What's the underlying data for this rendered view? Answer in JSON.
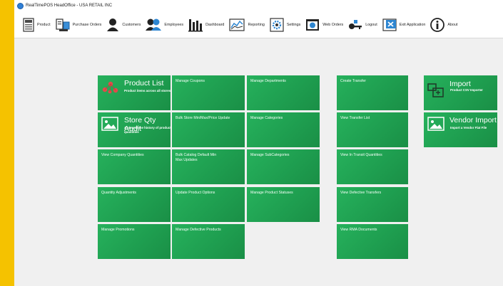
{
  "window": {
    "title": "RealTimePOS HeadOffice - USA RETAIL INC"
  },
  "toolbar": {
    "items": [
      {
        "label": "Product",
        "icon": "cash-register-icon"
      },
      {
        "label": "Purchase Orders",
        "icon": "purchase-orders-icon"
      },
      {
        "label": "Customers",
        "icon": "customers-icon"
      },
      {
        "label": "Employees",
        "icon": "employees-icon"
      },
      {
        "label": "Dashboard",
        "icon": "dashboard-icon"
      },
      {
        "label": "Reporting",
        "icon": "reporting-icon"
      },
      {
        "label": "Settings",
        "icon": "settings-icon"
      },
      {
        "label": "Web Orders",
        "icon": "web-orders-icon"
      },
      {
        "label": "Logout",
        "icon": "key-icon"
      },
      {
        "label": "Exit Application",
        "icon": "exit-icon"
      },
      {
        "label": "About",
        "icon": "info-icon"
      }
    ]
  },
  "tiles": {
    "product_list": {
      "title": "Product List",
      "subtitle": "Product items across all stores"
    },
    "store_qty_audit": {
      "title": "Store Qty Audit",
      "subtitle": "A view of the history of product quantities"
    },
    "view_company_quantities": "View Company Quantities",
    "quantity_adjustments": "Quantity Adjustments",
    "manage_promotions": "Manage Promotions",
    "manage_coupons": "Manage Coupons",
    "bulk_store_minmax": "Bulk Store Min/Max/Price Update",
    "bulk_catalog": "Bulk Catalog Default Min Max Updates",
    "update_product_options": "Update Product Options",
    "manage_defective_products": "Manage Defective Products",
    "manage_departments": "Manage Departments",
    "manage_categories": "Manage Categories",
    "manage_subcategories": "Manage SubCategories",
    "manage_product_statuses": "Manage Product Statuses",
    "create_transfer": "Create Transfer",
    "view_transfer_list": "View Transfer List",
    "view_in_transit": "View In Transit Quantities",
    "view_defective_transfers": "View Defective Transfers",
    "view_rma_documents": "View RMA Documents",
    "import": {
      "title": "Import",
      "subtitle": "Product CSV Importer"
    },
    "vendor_import": {
      "title": "Vendor Import",
      "subtitle": "Import a Vendor Flat File"
    }
  },
  "colors": {
    "tile_green": "#22a555",
    "accent_yellow": "#f5c200"
  }
}
